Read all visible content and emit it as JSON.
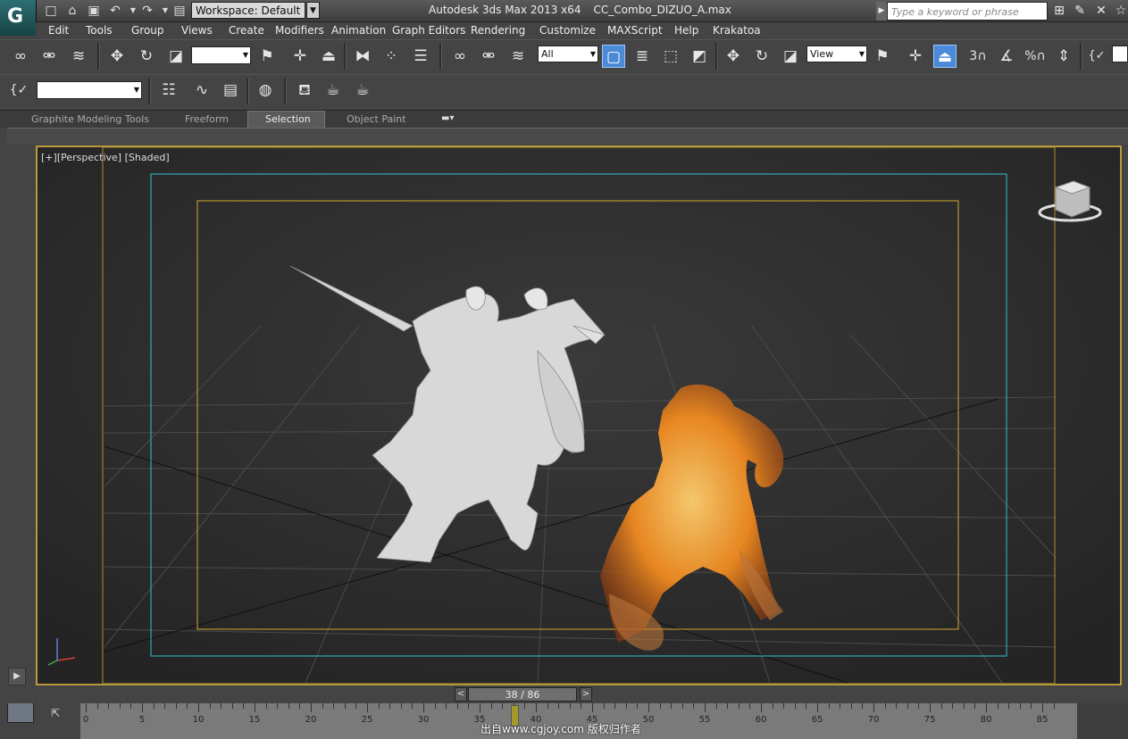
{
  "app": {
    "logo_glyph": "G",
    "title_app": "Autodesk 3ds Max  2013 x64",
    "title_file": "CC_Combo_DIZUO_A.max",
    "workspace_label": "Workspace: Default",
    "search_placeholder": "Type a keyword or phrase",
    "title_icons": [
      "binoculars-icon",
      "wrench-icon",
      "x-icon",
      "star-icon"
    ]
  },
  "menus": [
    "Edit",
    "Tools",
    "Group",
    "Views",
    "Create",
    "Modifiers",
    "Animation",
    "Graph Editors",
    "Rendering",
    "Customize",
    "MAXScript",
    "Help",
    "Krakatoa"
  ],
  "main_toolbar": {
    "selection_filter_value": "All",
    "ref_coord_value": "View",
    "snap_labels": [
      "3",
      "%"
    ]
  },
  "secondary_toolbar": {
    "named_selection_value": ""
  },
  "ribbon": {
    "tabs": [
      "Graphite Modeling Tools",
      "Freeform",
      "Selection",
      "Object Paint"
    ],
    "active_tab": "Selection"
  },
  "viewport": {
    "label_plus": "[+]",
    "label_view": "[Perspective]",
    "label_shading": "[Shaded]",
    "frame_border_color": "#b79a3a",
    "safe_frame_inner_color": "#d0a830",
    "safe_frame_outer_color": "#35c0d0"
  },
  "timeline": {
    "frame_counter": "38 / 86",
    "current_frame": 38,
    "total_frames": 86,
    "tick_labels": [
      "0",
      "5",
      "10",
      "15",
      "20",
      "25",
      "30",
      "35",
      "40",
      "45",
      "50",
      "55",
      "60",
      "65",
      "70",
      "75",
      "80",
      "85"
    ],
    "watermark": "出自www.cgjoy.com 版权归作者"
  }
}
